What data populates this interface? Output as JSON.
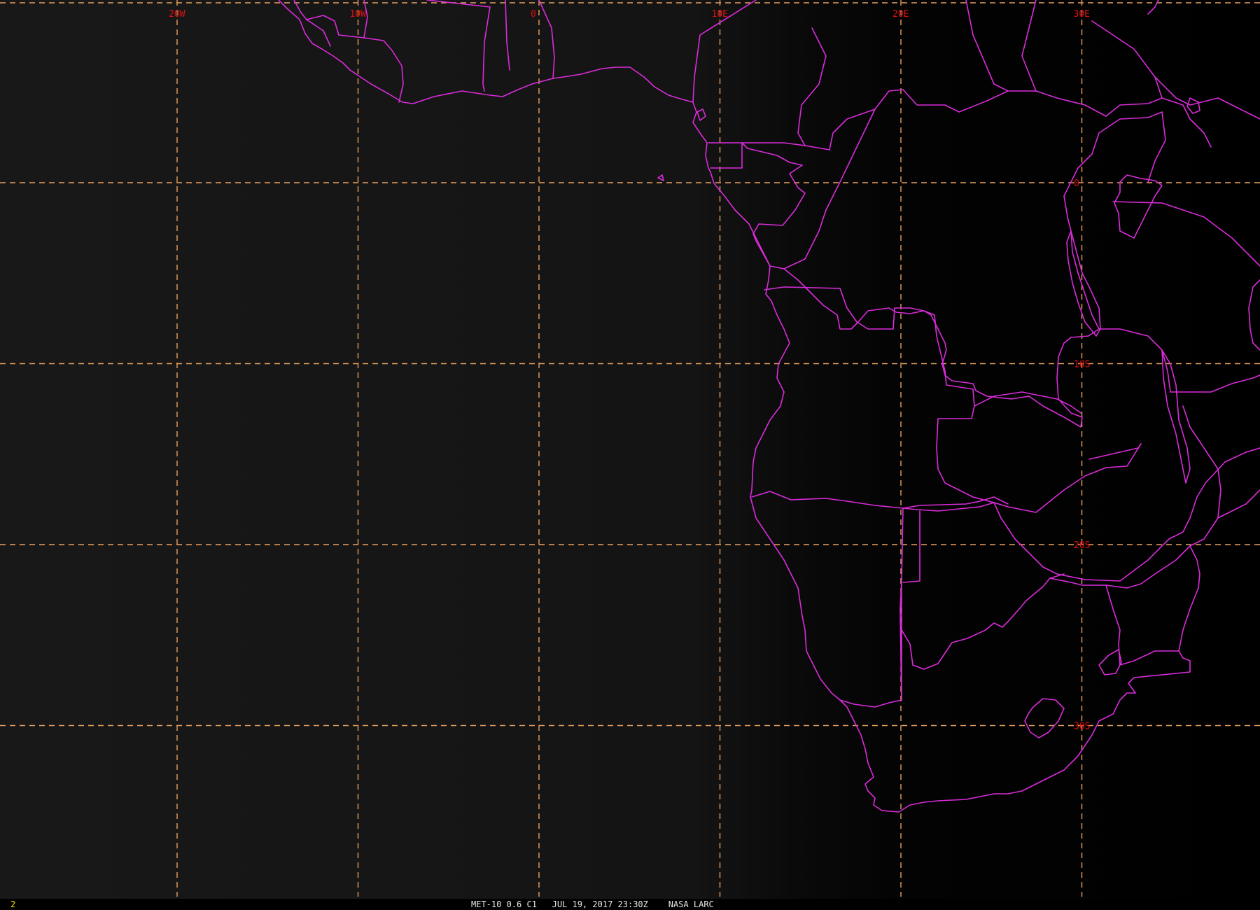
{
  "colors": {
    "background": "#000000",
    "land_sea_dark": "#141414",
    "grid": "#e8a060",
    "grid_labels": "#e01010",
    "borders": "#d92cd9",
    "caption": "#e6e6e6",
    "frame_number": "#e6e000"
  },
  "map": {
    "projection": "satellite full-disk sector, lat/lon graticule every 10 degrees",
    "lon_labels": [
      {
        "text": "20W",
        "lon": -20
      },
      {
        "text": "10W",
        "lon": -10
      },
      {
        "text": "0",
        "lon": 0
      },
      {
        "text": "10E",
        "lon": 10
      },
      {
        "text": "20E",
        "lon": 20
      },
      {
        "text": "30E",
        "lon": 30
      }
    ],
    "lat_labels": [
      {
        "text": "0",
        "lat": 0
      },
      {
        "text": "10S",
        "lat": -10
      },
      {
        "text": "20S",
        "lat": -20
      },
      {
        "text": "30S",
        "lat": -30
      }
    ]
  },
  "status_bar": {
    "frame_number": "2",
    "caption": "MET-10 0.6 C1   JUL 19, 2017 23:30Z    NASA LARC"
  }
}
